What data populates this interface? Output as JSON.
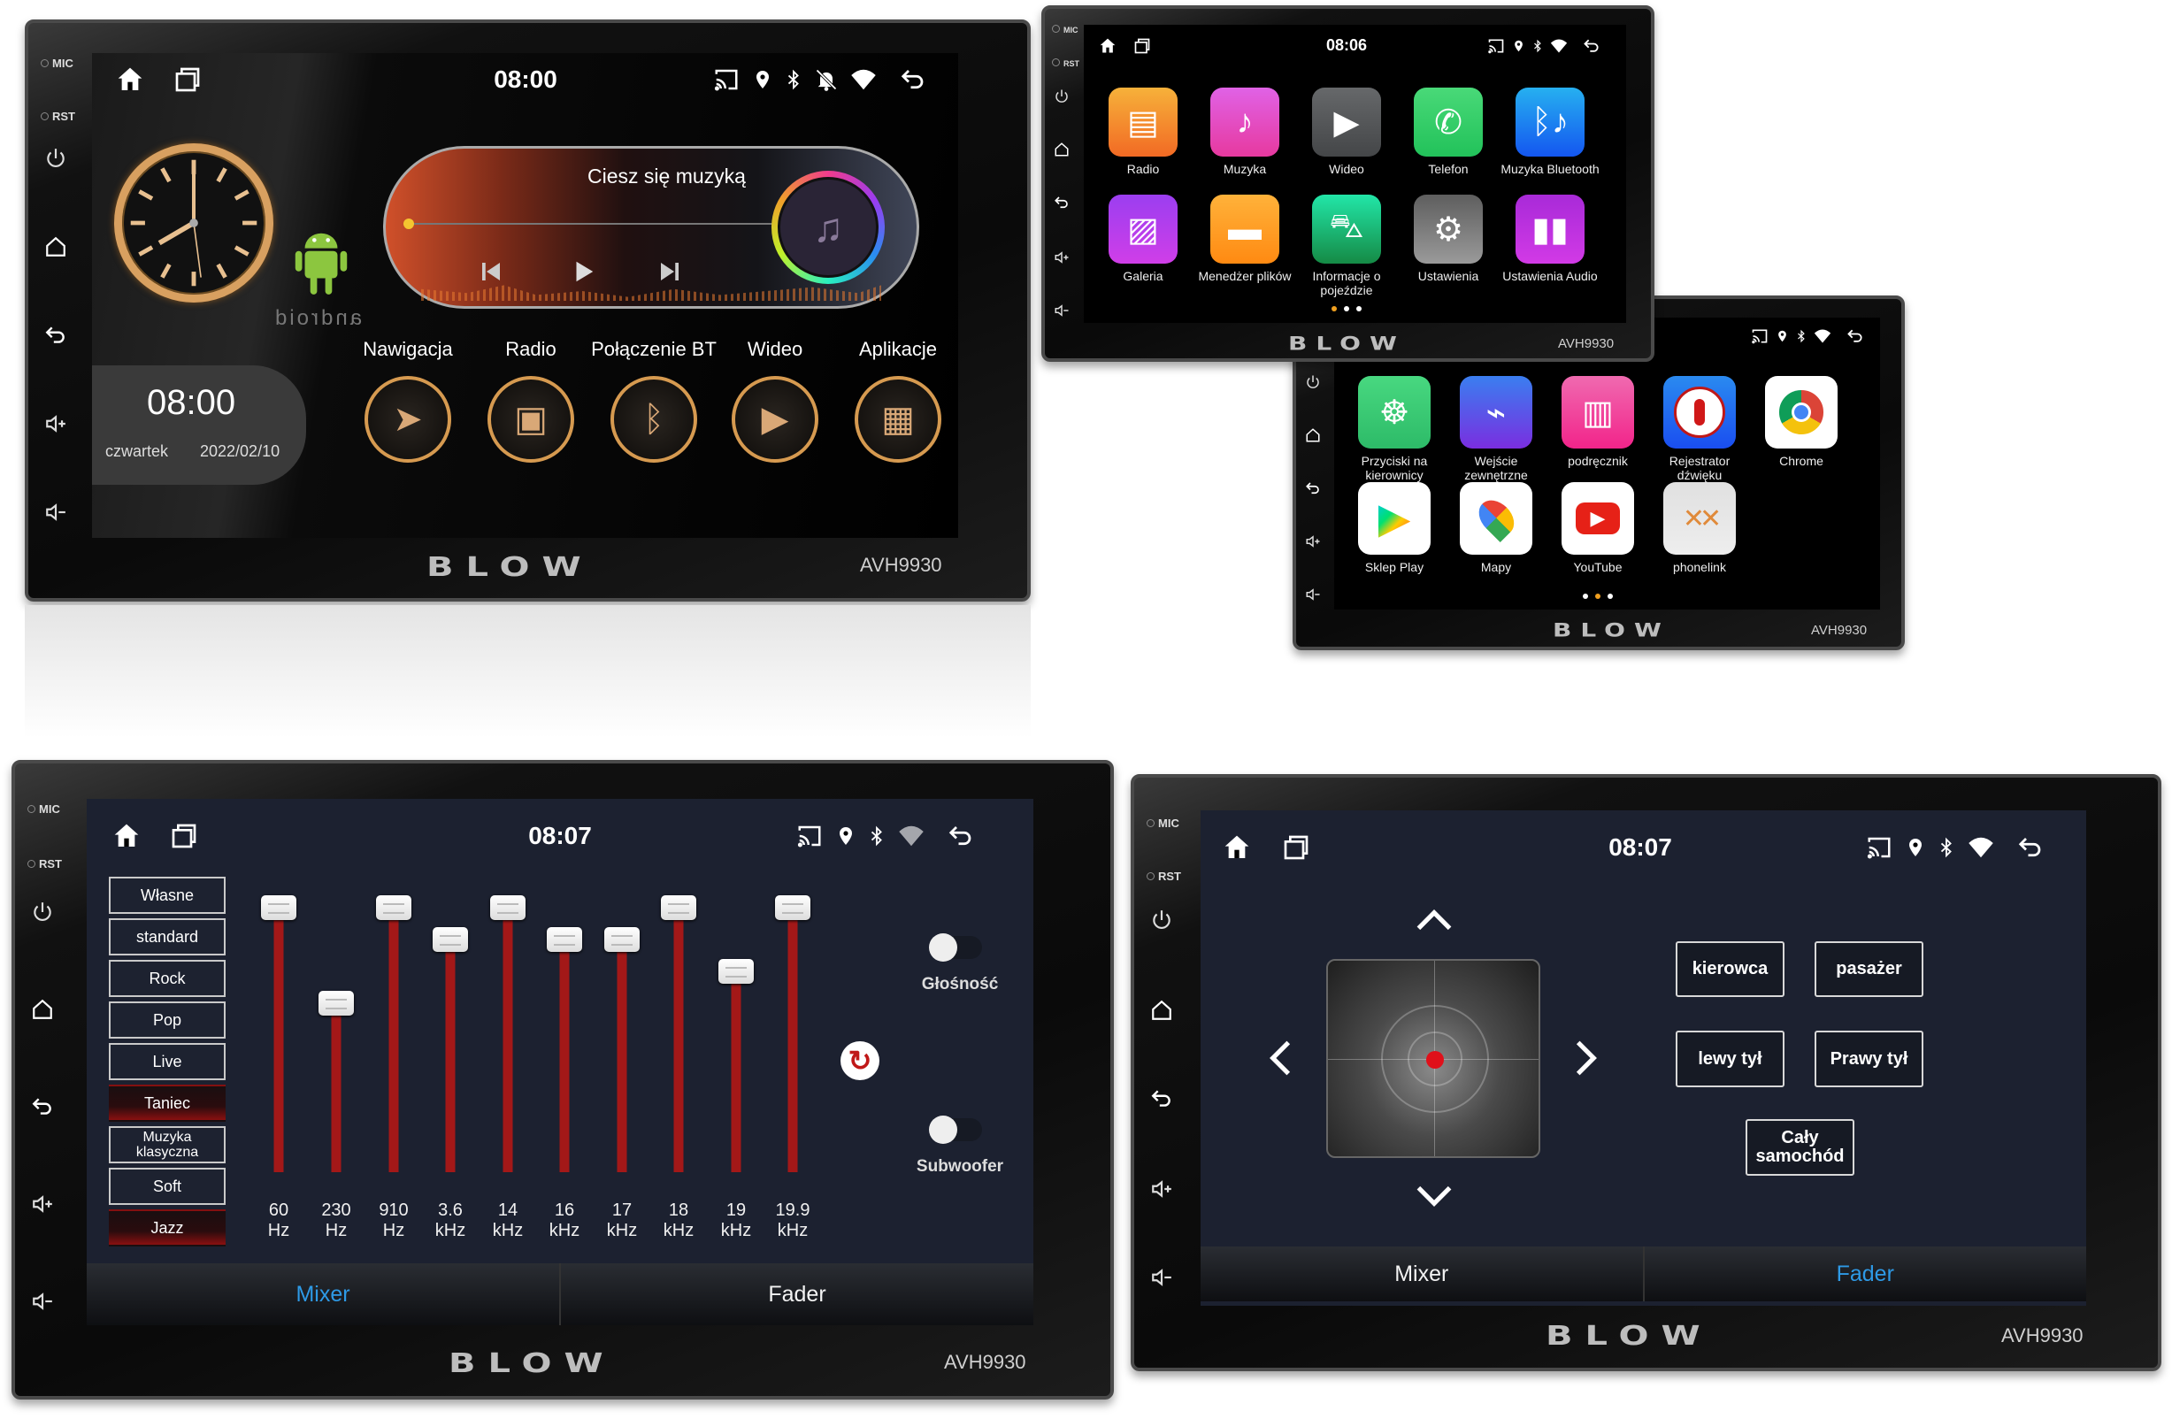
{
  "brand": "BLOW",
  "model": "AVH9930",
  "bezel": {
    "mic": "MIC",
    "rst": "RST"
  },
  "home_screen": {
    "time": "08:00",
    "clock_widget": {
      "time": "08:00",
      "day": "czwartek",
      "date": "2022/02/10"
    },
    "android_logo": "android",
    "music": {
      "title": "Ciesz się muzyką",
      "progress": 0
    },
    "shortcuts": [
      {
        "label": "Nawigacja",
        "icon": "navigation-icon"
      },
      {
        "label": "Radio",
        "icon": "radio-icon"
      },
      {
        "label": "Połączenie BT",
        "icon": "bluetooth-icon"
      },
      {
        "label": "Wideo",
        "icon": "play-icon"
      },
      {
        "label": "Aplikacje",
        "icon": "apps-grid-icon"
      }
    ]
  },
  "apps_page1": {
    "time": "08:06",
    "active_page": 1,
    "apps": [
      {
        "label": "Radio",
        "icon": "radio-icon",
        "color": "#f26a24",
        "color2": "#f6b13a"
      },
      {
        "label": "Muzyka",
        "icon": "music-note-icon",
        "color": "#e7399f",
        "color2": "#e062e6"
      },
      {
        "label": "Wideo",
        "icon": "play-icon",
        "color": "#444648",
        "color2": "#66686a"
      },
      {
        "label": "Telefon",
        "icon": "phone-icon",
        "color": "#22c25a",
        "color2": "#49d978"
      },
      {
        "label": "Muzyka Bluetooth",
        "icon": "bluetooth-music-icon",
        "color": "#1456f0",
        "color2": "#26b0f0"
      },
      {
        "label": "Galeria",
        "icon": "gallery-icon",
        "color": "#d03ee8",
        "color2": "#9b3ef0"
      },
      {
        "label": "Menedżer plików",
        "icon": "folder-icon",
        "color": "#ff8a12",
        "color2": "#ffb23a"
      },
      {
        "label": "Informacje o\npojeździe",
        "icon": "car-icon",
        "color": "#158a45",
        "color2": "#22e6a8"
      },
      {
        "label": "Ustawienia",
        "icon": "gear-icon",
        "color": "#9a9a9a",
        "color2": "#5e5e5e"
      },
      {
        "label": "Ustawienia Audio",
        "icon": "equalizer-icon",
        "color": "#d23ae6",
        "color2": "#a82ad8"
      }
    ]
  },
  "apps_page2": {
    "active_page": 2,
    "apps": [
      {
        "label": "Przyciski na\nkierownicy",
        "icon": "steering-wheel-icon",
        "color": "#2dbb68",
        "color2": "#48d880"
      },
      {
        "label": "Wejście\nzewnętrzne",
        "icon": "aux-cable-icon",
        "color": "#7a2ee0",
        "color2": "#3a7ef0"
      },
      {
        "label": "podręcznik",
        "icon": "book-icon",
        "color": "#f2248a",
        "color2": "#f06ab0"
      },
      {
        "label": "Rejestrator\ndźwięku",
        "icon": "microphone-icon",
        "color": "#1a4ef0",
        "color2": "#2a8af0"
      },
      {
        "label": "Chrome",
        "icon": "chrome-icon",
        "color": "#ffffff",
        "color2": "#ffffff"
      },
      {
        "label": "Sklep Play",
        "icon": "play-store-icon",
        "color": "#ffffff",
        "color2": "#ffffff"
      },
      {
        "label": "Mapy",
        "icon": "maps-icon",
        "color": "#ffffff",
        "color2": "#ffffff"
      },
      {
        "label": "YouTube",
        "icon": "youtube-icon",
        "color": "#ffffff",
        "color2": "#ffffff"
      },
      {
        "label": "phonelink",
        "icon": "phonelink-icon",
        "color": "#eeeeee",
        "color2": "#e0e0e0"
      }
    ]
  },
  "equalizer": {
    "time": "08:07",
    "presets": [
      {
        "label": "Własne",
        "active": false
      },
      {
        "label": "standard",
        "active": false
      },
      {
        "label": "Rock",
        "active": false
      },
      {
        "label": "Pop",
        "active": false
      },
      {
        "label": "Live",
        "active": false
      },
      {
        "label": "Taniec",
        "active": true
      },
      {
        "label": "Muzyka klasyczna",
        "active": false
      },
      {
        "label": "Soft",
        "active": false
      },
      {
        "label": "Jazz",
        "active": true
      }
    ],
    "bands": [
      {
        "freq": "60",
        "unit": "Hz",
        "level": 1.0
      },
      {
        "freq": "230",
        "unit": "Hz",
        "level": 0.64
      },
      {
        "freq": "910",
        "unit": "Hz",
        "level": 1.0
      },
      {
        "freq": "3.6",
        "unit": "kHz",
        "level": 0.88
      },
      {
        "freq": "14",
        "unit": "kHz",
        "level": 1.0
      },
      {
        "freq": "16",
        "unit": "kHz",
        "level": 0.88
      },
      {
        "freq": "17",
        "unit": "kHz",
        "level": 0.88
      },
      {
        "freq": "18",
        "unit": "kHz",
        "level": 1.0
      },
      {
        "freq": "19",
        "unit": "kHz",
        "level": 0.76
      },
      {
        "freq": "19.9",
        "unit": "kHz",
        "level": 1.0
      }
    ],
    "toggles": [
      {
        "label": "Głośność",
        "on": false
      },
      {
        "label": "Subwoofer",
        "on": false
      }
    ],
    "tabs": [
      {
        "label": "Mixer",
        "active": true
      },
      {
        "label": "Fader",
        "active": false
      }
    ]
  },
  "fader": {
    "time": "08:07",
    "buttons": {
      "driver": "kierowca",
      "passenger": "pasażer",
      "rear_left": "lewy tył",
      "rear_right": "Prawy tył",
      "whole_car": "Cały samochód"
    },
    "tabs": [
      {
        "label": "Mixer",
        "active": false
      },
      {
        "label": "Fader",
        "active": true
      }
    ]
  }
}
